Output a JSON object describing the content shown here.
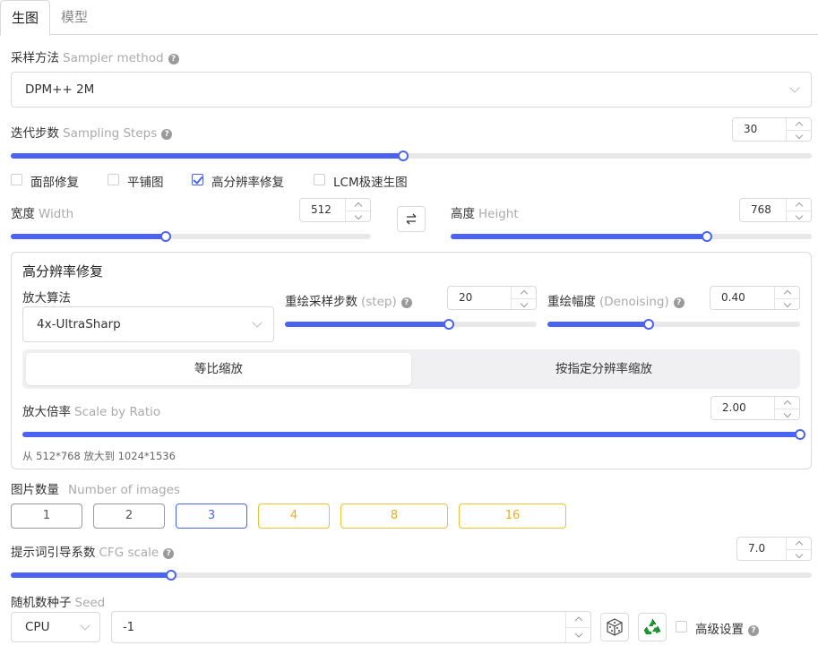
{
  "tabs": [
    {
      "label": "生图",
      "active": true
    },
    {
      "label": "模型",
      "active": false
    }
  ],
  "sampler": {
    "label": "采样方法",
    "label_en": "Sampler method",
    "value": "DPM++ 2M"
  },
  "steps": {
    "label": "迭代步数",
    "label_en": "Sampling Steps",
    "value": "30",
    "fraction": 0.49
  },
  "checkboxes": [
    {
      "label": "面部修复",
      "checked": false
    },
    {
      "label": "平铺图",
      "checked": false
    },
    {
      "label": "高分辨率修复",
      "checked": true
    },
    {
      "label": "LCM极速生图",
      "checked": false
    }
  ],
  "width": {
    "label": "宽度",
    "label_en": "Width",
    "value": "512",
    "fraction": 0.43
  },
  "height": {
    "label": "高度",
    "label_en": "Height",
    "value": "768",
    "fraction": 0.71
  },
  "swap_icon": "swap-arrows-icon",
  "hires": {
    "title": "高分辨率修复",
    "upscaler_label": "放大算法",
    "upscaler_value": "4x-UltraSharp",
    "redraw_steps": {
      "label": "重绘采样步数",
      "label_en": "(step)",
      "value": "20",
      "fraction": 0.65
    },
    "denoise": {
      "label": "重绘幅度",
      "label_en": "(Denoising)",
      "value": "0.40",
      "fraction": 0.4
    },
    "modes": [
      {
        "label": "等比缩放",
        "selected": true
      },
      {
        "label": "按指定分辨率缩放",
        "selected": false
      }
    ],
    "scale": {
      "label": "放大倍率",
      "label_en": "Scale by Ratio",
      "value": "2.00",
      "fraction": 1.0
    },
    "note": "从 512*768 放大到 1024*1536"
  },
  "num_images": {
    "label": "图片数量",
    "label_en": "Number of images",
    "options": [
      {
        "label": "1",
        "color": "#999999",
        "text": "#555555"
      },
      {
        "label": "2",
        "color": "#999999",
        "text": "#555555"
      },
      {
        "label": "3",
        "color": "#4b63f2",
        "text": "#4b63f2"
      },
      {
        "label": "4",
        "color": "#f0c030",
        "text": "#e8b020"
      },
      {
        "label": "8",
        "color": "#f0c030",
        "text": "#e8b020"
      },
      {
        "label": "16",
        "color": "#f0c030",
        "text": "#e8b020"
      }
    ]
  },
  "cfg": {
    "label": "提示词引导系数",
    "label_en": "CFG scale",
    "value": "7.0",
    "fraction": 0.2
  },
  "seed": {
    "label": "随机数种子",
    "label_en": "Seed",
    "device": "CPU",
    "value": "-1",
    "dice_icon": "dice-icon",
    "recycle_icon": "recycle-icon",
    "advanced_label": "高级设置",
    "advanced_checked": false
  },
  "colors": {
    "accent": "#4b63f2",
    "recycle": "#1a9a2a"
  }
}
